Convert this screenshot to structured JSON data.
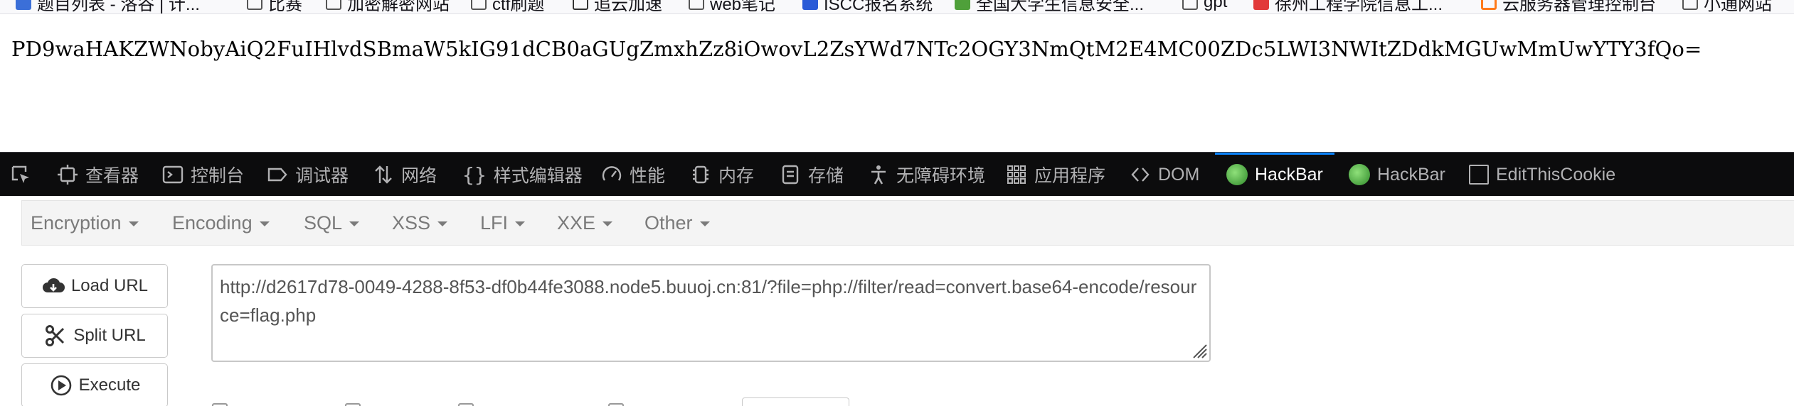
{
  "bookmarks": [
    {
      "label": "题目列表 - 洛谷 | 计...",
      "icon": "x-logo-icon"
    },
    {
      "label": "比赛",
      "icon": "folder-icon"
    },
    {
      "label": "加密解密网站",
      "icon": "folder-icon"
    },
    {
      "label": "ctf刷题",
      "icon": "folder-icon"
    },
    {
      "label": "追云加速",
      "icon": "globe-icon"
    },
    {
      "label": "web笔记",
      "icon": "folder-icon"
    },
    {
      "label": "ISCC报名系统",
      "icon": "iscc-icon"
    },
    {
      "label": "全国大学生信息安全...",
      "icon": "green-logo-icon"
    },
    {
      "label": "gpt",
      "icon": "folder-icon"
    },
    {
      "label": "徐州工程学院信息工...",
      "icon": "red-logo-icon"
    },
    {
      "label": "云服务器管理控制台",
      "icon": "aliyun-icon"
    },
    {
      "label": "小通网站",
      "icon": "folder-icon"
    }
  ],
  "page": {
    "output": "PD9waHAKZWNobyAiQ2FuIHlvdSBmaW5kIG91dCB0aGUgZmxhZz8iOwovL2ZsYWd7NTc2OGY3NmQtM2E4MC00ZDc5LWI3NWItZDdkMGUwMmUwYTY3fQo="
  },
  "devtools": {
    "tabs": [
      {
        "label": "",
        "icon": "element-picker-icon"
      },
      {
        "label": "查看器",
        "icon": "inspector-icon"
      },
      {
        "label": "控制台",
        "icon": "console-icon"
      },
      {
        "label": "调试器",
        "icon": "debugger-icon"
      },
      {
        "label": "网络",
        "icon": "network-icon"
      },
      {
        "label": "样式编辑器",
        "icon": "style-editor-icon"
      },
      {
        "label": "性能",
        "icon": "performance-icon"
      },
      {
        "label": "内存",
        "icon": "memory-icon"
      },
      {
        "label": "存储",
        "icon": "storage-icon"
      },
      {
        "label": "无障碍环境",
        "icon": "accessibility-icon"
      },
      {
        "label": "应用程序",
        "icon": "application-icon"
      },
      {
        "label": "DOM",
        "icon": "dom-icon"
      },
      {
        "label": "HackBar",
        "icon": "hackbar-icon",
        "active": true
      },
      {
        "label": "HackBar",
        "icon": "hackbar-icon"
      },
      {
        "label": "EditThisCookie",
        "icon": "cookie-icon"
      }
    ],
    "accent_color": "#0a84ff"
  },
  "hackbar": {
    "menus": [
      "Encryption",
      "Encoding",
      "SQL",
      "XSS",
      "LFI",
      "XXE",
      "Other"
    ],
    "buttons": {
      "load_url": "Load URL",
      "split_url": "Split URL",
      "execute": "Execute"
    },
    "url_value": "http://d2617d78-0049-4288-8f53-df0b44fe3088.node5.buuoj.cn:81/?file=php://filter/read=convert.base64-encode/resource=flag.php"
  }
}
